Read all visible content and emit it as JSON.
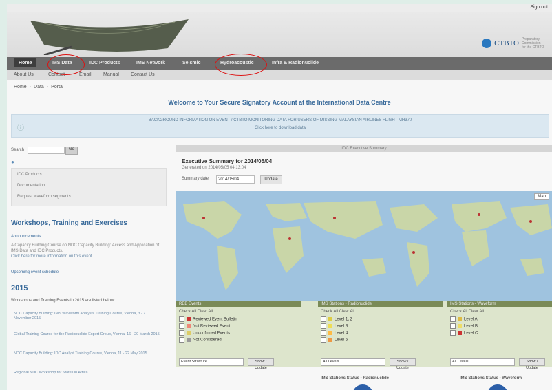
{
  "colors": {
    "accent": "#3a6b9b",
    "nav": "#6b6b6b",
    "highlight": "#d11"
  },
  "header": {
    "account_link": "Sign out",
    "logo_text": "CTBTO",
    "logo_sub": "Preparatory Commission for the CTBTO"
  },
  "nav": {
    "home": "Home",
    "items": [
      "IMS Data",
      "IDC Products",
      "IMS Network",
      "Seismic",
      "Hydroacoustic",
      "Infra & Radionuclide"
    ]
  },
  "subnav": [
    "About Us",
    "Contact",
    "Email",
    "Manual",
    "Contact Us"
  ],
  "breadcrumb": {
    "parts": [
      "Home",
      "Data",
      "Portal"
    ]
  },
  "welcome": "Welcome to Your Secure Signatory Account at the International Data Centre",
  "notice": {
    "line1": "BACKGROUND INFORMATION ON EVENT / CTBTO MONITORING DATA FOR USERS OF MISSING MALAYSIAN AIRLINES FLIGHT MH370",
    "line2": "Click here to download data"
  },
  "sidebar": {
    "search_label": "Search",
    "go_label": "Go",
    "menu_items": [
      "IDC Products",
      "Documentation",
      "Request waveform segments"
    ],
    "section_title": "Workshops, Training and Exercises",
    "announcements_label": "Announcements",
    "announcement_text": "A Capacity Building Course on NDC Capacity Building: Access and Application of IMS Data and IDC Products.",
    "announcement_link": "Click here for more information on this event",
    "upcoming_label": "Upcoming event schedule",
    "year": "2015",
    "intro": "Workshops and Training Events in 2015 are listed below:",
    "events": [
      "NDC Capacity Building: IMS Waveform Analysis Training Course, Vienna, 3 - 7 November 2015",
      "Global Training Course for the Radionuclide Expert Group, Vienna, 16 - 20 March 2015",
      "NDC Capacity Building: IDC Analyst Training Course, Vienna, 11 - 22 May 2015",
      "Regional NDC Workshop for States in Africa"
    ]
  },
  "main": {
    "panel_title": "IDC Executive Summary",
    "exec_title": "Executive Summary for 2014/05/04",
    "generated": "Generated on 2014/05/05 04:13:04",
    "date_label": "Summary date",
    "date_value": "2014/05/04",
    "update_label": "Update",
    "map_type": "Map"
  },
  "filters": [
    {
      "header": "REB Events",
      "sub": "Check All  Clear All",
      "items": [
        "Reviewed Event Bulletin",
        "Not Reviewed Event",
        "Unconfirmed Events",
        "Not Considered"
      ],
      "select": "Event Structure",
      "button": "Show / Update"
    },
    {
      "header": "IMS Stations - Radionuclide",
      "sub": "Check All  Clear All",
      "items": [
        "Level 1, 2",
        "Level 3",
        "Level 4",
        "Level 5"
      ],
      "select": "All Levels",
      "button": "Show / Update"
    },
    {
      "header": "IMS Stations - Waveform",
      "sub": "Check All  Clear All",
      "items": [
        "Level A",
        "Level B",
        "Level C"
      ],
      "select": "All Levels",
      "button": "Show / Update"
    }
  ],
  "bottom": {
    "left_label": "IMS Stations Status - Radionuclide",
    "right_label": "IMS Stations Status - Waveform"
  }
}
